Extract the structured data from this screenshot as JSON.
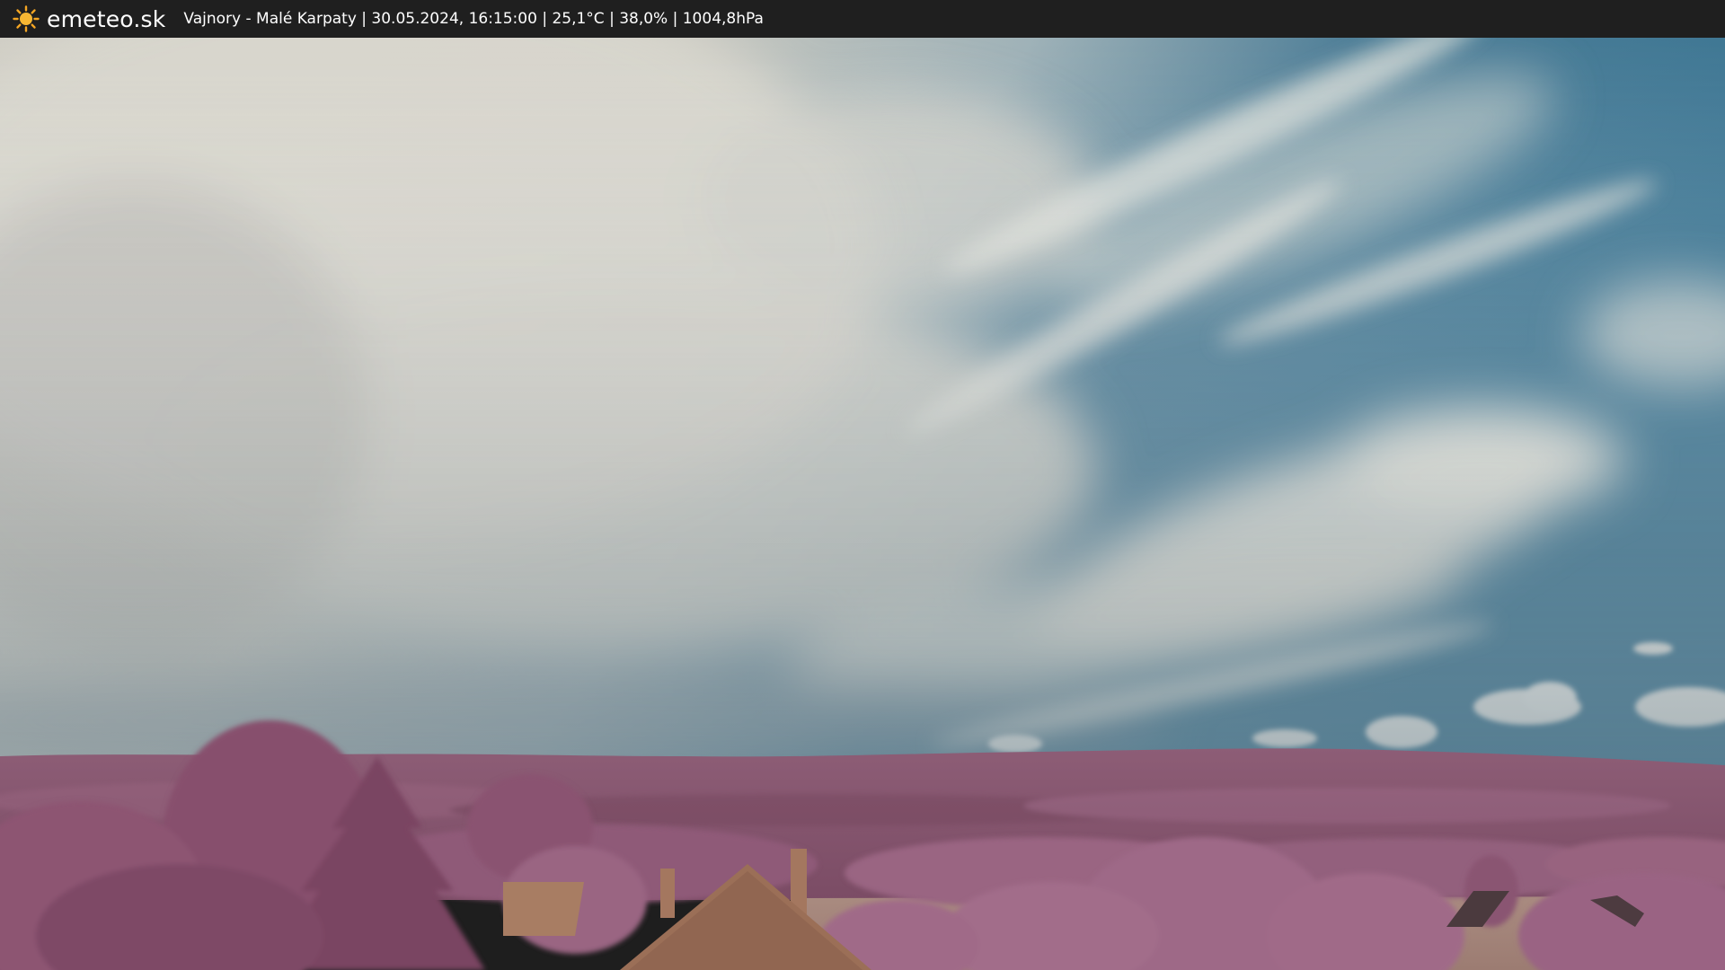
{
  "header": {
    "logo_text": "emeteo.sk",
    "caption": "Vajnory - Malé Karpaty | 30.05.2024, 16:15:00 | 25,1°C | 38,0% | 1004,8hPa"
  },
  "icons": {
    "logo": "sun-icon"
  },
  "colors": {
    "bar": "#1f1f1f",
    "sun": "#f5a623",
    "sky_blue": "#3d7a94",
    "cloud": "#d9d8cf",
    "foliage": "#a06b86",
    "hills": "#8a5a73",
    "field": "#a88a80"
  }
}
